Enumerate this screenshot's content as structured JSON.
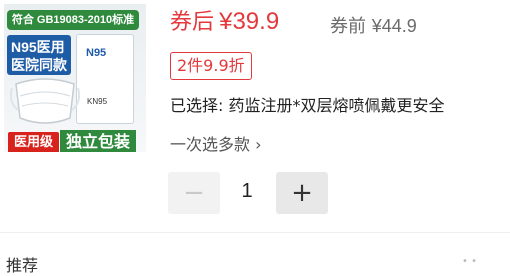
{
  "product_image": {
    "standard_banner": "符合 GB19083-2010标准",
    "badge_line1": "N95医用",
    "badge_line2": "医院同款",
    "box_label": "N95",
    "box_label2": "KN95",
    "tag_medical": "医用级",
    "tag_individual": "独立包装"
  },
  "price": {
    "after_label": "券后",
    "after_value": "¥39.9",
    "before_label": "券前",
    "before_value": "¥44.9"
  },
  "promo": {
    "tag": "2件9.9折"
  },
  "selection": {
    "text": "已选择: 药监注册*双层熔喷佩戴更安全",
    "multi_select": "一次选多款 ›"
  },
  "quantity": {
    "minus": "−",
    "value": "1",
    "plus": "+"
  },
  "bottom": {
    "partial_label": "推荐"
  }
}
